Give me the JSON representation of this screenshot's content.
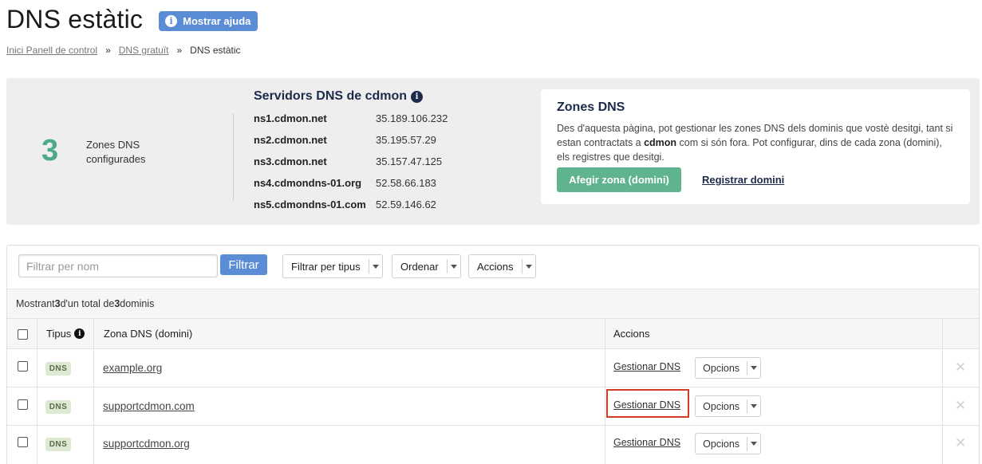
{
  "page": {
    "title": "DNS estàtic",
    "help_button": "Mostrar ajuda",
    "help_icon": "i"
  },
  "breadcrumb": {
    "home": "Inici Panell de control",
    "sep1": "»",
    "free_dns": "DNS gratuït",
    "sep2": "»",
    "current": "DNS estàtic"
  },
  "summary": {
    "zones_count": "3",
    "zones_label": "Zones DNS configurades",
    "servers_title": "Servidors DNS de cdmon",
    "servers_info_icon": "i",
    "servers": [
      {
        "name": "ns1.cdmon.net",
        "ip": "35.189.106.232"
      },
      {
        "name": "ns2.cdmon.net",
        "ip": "35.195.57.29"
      },
      {
        "name": "ns3.cdmon.net",
        "ip": "35.157.47.125"
      },
      {
        "name": "ns4.cdmondns-01.org",
        "ip": "52.58.66.183"
      },
      {
        "name": "ns5.cdmondns-01.com",
        "ip": "52.59.146.62"
      }
    ]
  },
  "zones_card": {
    "title": "Zones DNS",
    "desc_part1": "Des d'aquesta pàgina, pot gestionar les zones DNS dels dominis que vostè desitgi, tant si estan contractats a ",
    "desc_bold": "cdmon",
    "desc_part2": " com si són fora. Pot configurar, dins de cada zona (domini), els registres que desitgi.",
    "add_button": "Afegir zona (domini)",
    "register_link": "Registrar domini"
  },
  "toolbar": {
    "filter_placeholder": "Filtrar per nom",
    "filter_button": "Filtrar",
    "filter_type": "Filtrar per tipus",
    "sort": "Ordenar",
    "actions": "Accions"
  },
  "results": {
    "prefix": "Mostrant ",
    "shown": "3",
    "middle": " d'un total de ",
    "total": "3",
    "suffix": " dominis"
  },
  "table": {
    "col_type": "Tipus",
    "col_type_icon": "i",
    "col_zone": "Zona DNS (domini)",
    "col_actions": "Accions",
    "rows": [
      {
        "type": "DNS",
        "domain": "example.org",
        "manage": "Gestionar DNS",
        "options": "Opcions",
        "delete": "✕"
      },
      {
        "type": "DNS",
        "domain": "supportcdmon.com",
        "manage": "Gestionar DNS",
        "options": "Opcions",
        "delete": "✕"
      },
      {
        "type": "DNS",
        "domain": "supportcdmon.org",
        "manage": "Gestionar DNS",
        "options": "Opcions",
        "delete": "✕"
      }
    ]
  },
  "colors": {
    "accent_blue": "#5b8cd6",
    "accent_green": "#5fb38e",
    "highlight_red": "#d23b2a"
  }
}
